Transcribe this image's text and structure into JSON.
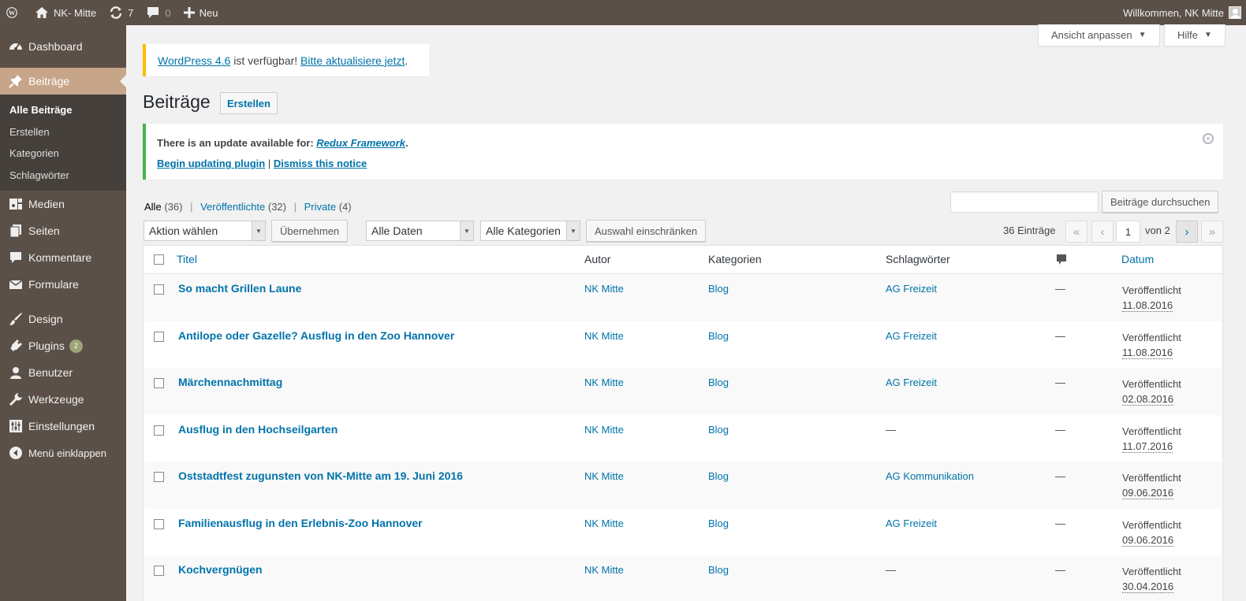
{
  "adminbar": {
    "site_name": "NK- Mitte",
    "updates_count": "7",
    "comments_count": "0",
    "new_label": "Neu",
    "welcome": "Willkommen, NK Mitte"
  },
  "sidebar": {
    "dashboard": "Dashboard",
    "posts": "Beiträge",
    "sub": [
      "Alle Beiträge",
      "Erstellen",
      "Kategorien",
      "Schlagwörter"
    ],
    "media": "Medien",
    "pages": "Seiten",
    "comments": "Kommentare",
    "forms": "Formulare",
    "design": "Design",
    "plugins": "Plugins",
    "plugins_badge": "2",
    "users": "Benutzer",
    "tools": "Werkzeuge",
    "settings": "Einstellungen",
    "collapse": "Menü einklappen"
  },
  "screen_options": {
    "label": "Ansicht anpassen",
    "help": "Hilfe"
  },
  "update_notice": {
    "link1": "WordPress 4.6",
    "text": " ist verfügbar! ",
    "link2": "Bitte aktualisiere jetzt",
    "end": "."
  },
  "page": {
    "title": "Beiträge",
    "add_new": "Erstellen"
  },
  "plugin_notice": {
    "text": "There is an update available for: ",
    "plugin": "Redux Framework",
    "end": ".",
    "begin": "Begin updating plugin",
    "sep": " | ",
    "dismiss": "Dismiss this notice"
  },
  "filters": {
    "all": "Alle",
    "all_count": "(36)",
    "published": "Veröffentlichte",
    "published_count": "(32)",
    "private": "Private",
    "private_count": "(4)",
    "search_button": "Beiträge durchsuchen",
    "bulk_action": "Aktion wählen",
    "apply": "Übernehmen",
    "dates": "Alle Daten",
    "categories": "Alle Kategorien",
    "filter": "Auswahl einschränken"
  },
  "pagination": {
    "count": "36 Einträge",
    "first": "«",
    "prev": "‹",
    "current": "1",
    "of": "von 2",
    "next": "›",
    "last": "»"
  },
  "table": {
    "headers": {
      "title": "Titel",
      "author": "Autor",
      "categories": "Kategorien",
      "tags": "Schlagwörter",
      "date": "Datum"
    },
    "rows": [
      {
        "title": "So macht Grillen Laune",
        "author": "NK Mitte",
        "category": "Blog",
        "tags": "AG Freizeit",
        "comments": "—",
        "status": "Veröffentlicht",
        "date": "11.08.2016"
      },
      {
        "title": "Antilope oder Gazelle? Ausflug in den Zoo Hannover",
        "author": "NK Mitte",
        "category": "Blog",
        "tags": "AG Freizeit",
        "comments": "—",
        "status": "Veröffentlicht",
        "date": "11.08.2016"
      },
      {
        "title": "Märchennachmittag",
        "author": "NK Mitte",
        "category": "Blog",
        "tags": "AG Freizeit",
        "comments": "—",
        "status": "Veröffentlicht",
        "date": "02.08.2016"
      },
      {
        "title": "Ausflug in den Hochseilgarten",
        "author": "NK Mitte",
        "category": "Blog",
        "tags": "—",
        "comments": "—",
        "status": "Veröffentlicht",
        "date": "11.07.2016"
      },
      {
        "title": "Oststadtfest zugunsten von NK-Mitte am 19. Juni 2016",
        "author": "NK Mitte",
        "category": "Blog",
        "tags": "AG Kommunikation",
        "comments": "—",
        "status": "Veröffentlicht",
        "date": "09.06.2016"
      },
      {
        "title": "Familienausflug in den Erlebnis-Zoo Hannover",
        "author": "NK Mitte",
        "category": "Blog",
        "tags": "AG Freizeit",
        "comments": "—",
        "status": "Veröffentlicht",
        "date": "09.06.2016"
      },
      {
        "title": "Kochvergnügen",
        "author": "NK Mitte",
        "category": "Blog",
        "tags": "—",
        "comments": "—",
        "status": "Veröffentlicht",
        "date": "30.04.2016"
      }
    ]
  }
}
